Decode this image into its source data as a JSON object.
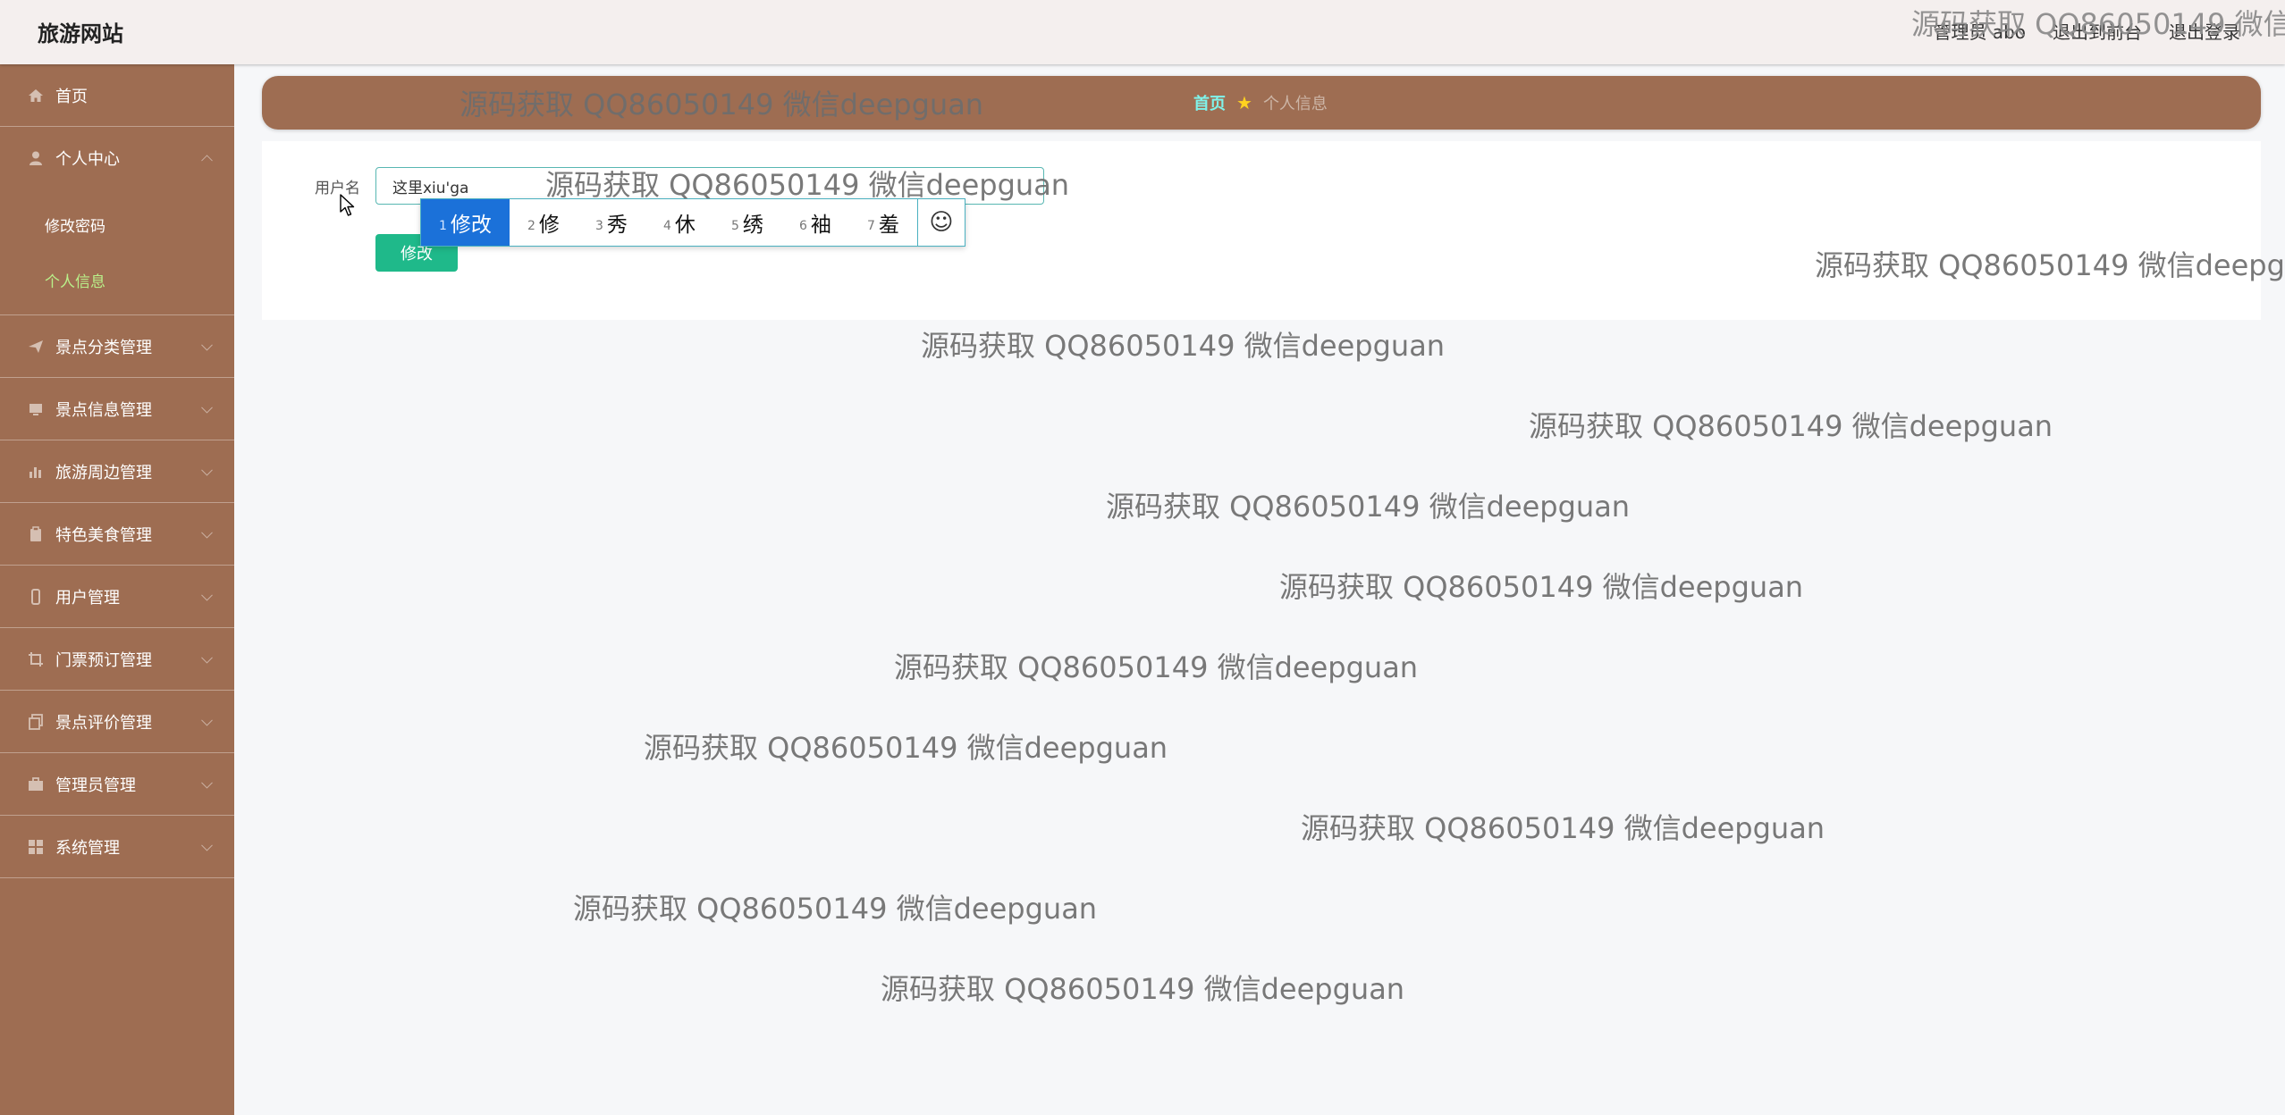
{
  "header": {
    "title": "旅游网站",
    "admin_label": "管理员 abo",
    "to_front_label": "退出到前台",
    "logout_label": "退出登录"
  },
  "sidebar": {
    "items": [
      {
        "label": "首页",
        "icon": "home-icon"
      },
      {
        "label": "个人中心",
        "icon": "user-icon",
        "expanded": true,
        "children": [
          {
            "label": "修改密码"
          },
          {
            "label": "个人信息",
            "active": true
          }
        ]
      },
      {
        "label": "景点分类管理",
        "icon": "paper-plane-icon"
      },
      {
        "label": "景点信息管理",
        "icon": "monitor-icon"
      },
      {
        "label": "旅游周边管理",
        "icon": "bar-chart-icon"
      },
      {
        "label": "特色美食管理",
        "icon": "clipboard-icon"
      },
      {
        "label": "用户管理",
        "icon": "mobile-icon"
      },
      {
        "label": "门票预订管理",
        "icon": "crop-icon"
      },
      {
        "label": "景点评价管理",
        "icon": "copy-icon"
      },
      {
        "label": "管理员管理",
        "icon": "briefcase-icon"
      },
      {
        "label": "系统管理",
        "icon": "grid-icon"
      }
    ]
  },
  "breadcrumb": {
    "home": "首页",
    "current": "个人信息"
  },
  "form": {
    "username_label": "用户名",
    "username_value": "这里xiu'ga",
    "submit_label": "修改"
  },
  "ime": {
    "candidates": [
      {
        "index": "1",
        "text": "修改"
      },
      {
        "index": "2",
        "text": "修"
      },
      {
        "index": "3",
        "text": "秀"
      },
      {
        "index": "4",
        "text": "休"
      },
      {
        "index": "5",
        "text": "绣"
      },
      {
        "index": "6",
        "text": "袖"
      },
      {
        "index": "7",
        "text": "羞"
      }
    ],
    "emoji_icon": "smiley-icon"
  },
  "watermark": "源码获取 QQ86050149 微信deepguan",
  "colors": {
    "sidebar_bg": "#9e6d52",
    "active_menu_text": "#b9f08a",
    "breadcrumb_home": "#7ff3ea",
    "submit_button": "#1fb98a",
    "ime_highlight": "#1b71d9"
  }
}
